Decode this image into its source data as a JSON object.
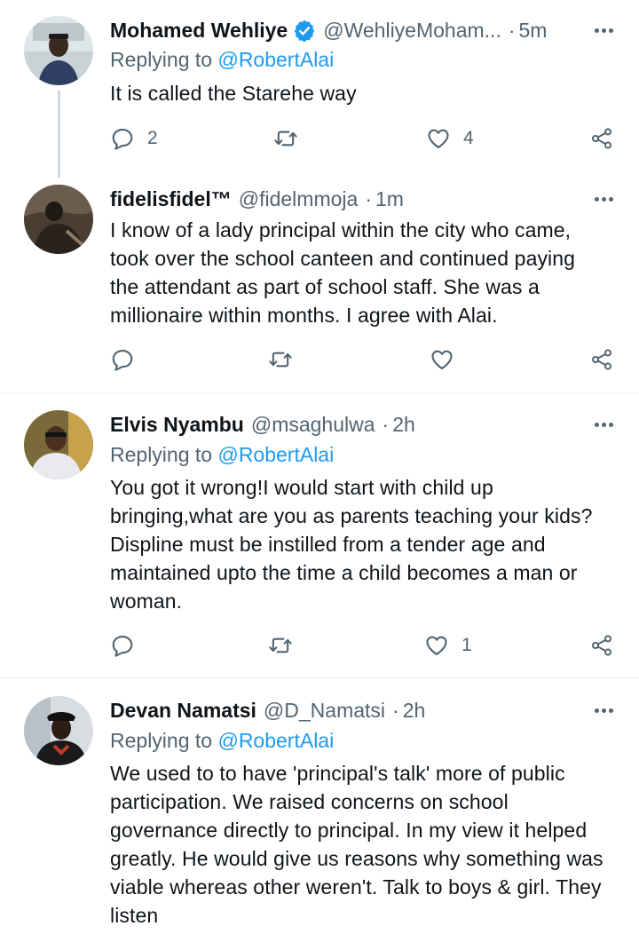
{
  "colors": {
    "link": "#1d9bf0",
    "secondary": "#536471",
    "text": "#0f1419",
    "verified": "#1d9bf0"
  },
  "tweets": [
    {
      "name": "Mohamed Wehliye",
      "verified": true,
      "handle": "@WehliyeMoham...",
      "time": "5m",
      "replying_prefix": "Replying to",
      "replying_to": "@RobertAlai",
      "text": "It is called the Starehe way",
      "replies": "2",
      "retweets": "",
      "likes": "4"
    },
    {
      "name": "fidelisfidel™",
      "verified": false,
      "handle": "@fidelmmoja",
      "time": "1m",
      "text_lines": [
        "I know of a lady principal within the city who came,",
        "took over the school canteen and continued paying",
        "the attendant as part of school staff. She was a",
        "millionaire within months. I agree with Alai."
      ],
      "replies": "",
      "retweets": "",
      "likes": ""
    },
    {
      "name": "Elvis Nyambu",
      "verified": false,
      "handle": "@msaghulwa",
      "time": "2h",
      "replying_prefix": "Replying to",
      "replying_to": "@RobertAlai",
      "text_lines": [
        "You got it wrong!I would start with child up",
        "bringing,what are you as parents teaching your kids?",
        "Displine must be instilled from a tender age and",
        "maintained upto the time a child becomes a man or",
        "woman."
      ],
      "replies": "",
      "retweets": "",
      "likes": "1"
    },
    {
      "name": "Devan Namatsi",
      "verified": false,
      "handle": "@D_Namatsi",
      "time": "2h",
      "replying_prefix": "Replying to",
      "replying_to": "@RobertAlai",
      "text_lines": [
        "We used to to have 'principal's talk' more of public",
        "participation. We raised concerns on school",
        "governance directly to principal. In my view it helped",
        "greatly. He would give us reasons why something was",
        "viable whereas other weren't. Talk to boys & girl. They",
        "listen"
      ]
    }
  ],
  "separator": "·",
  "icons": {
    "reply": "reply-icon",
    "retweet": "retweet-icon",
    "like": "heart-icon",
    "share": "share-icon",
    "more": "more-icon",
    "verified": "verified-badge-icon"
  }
}
